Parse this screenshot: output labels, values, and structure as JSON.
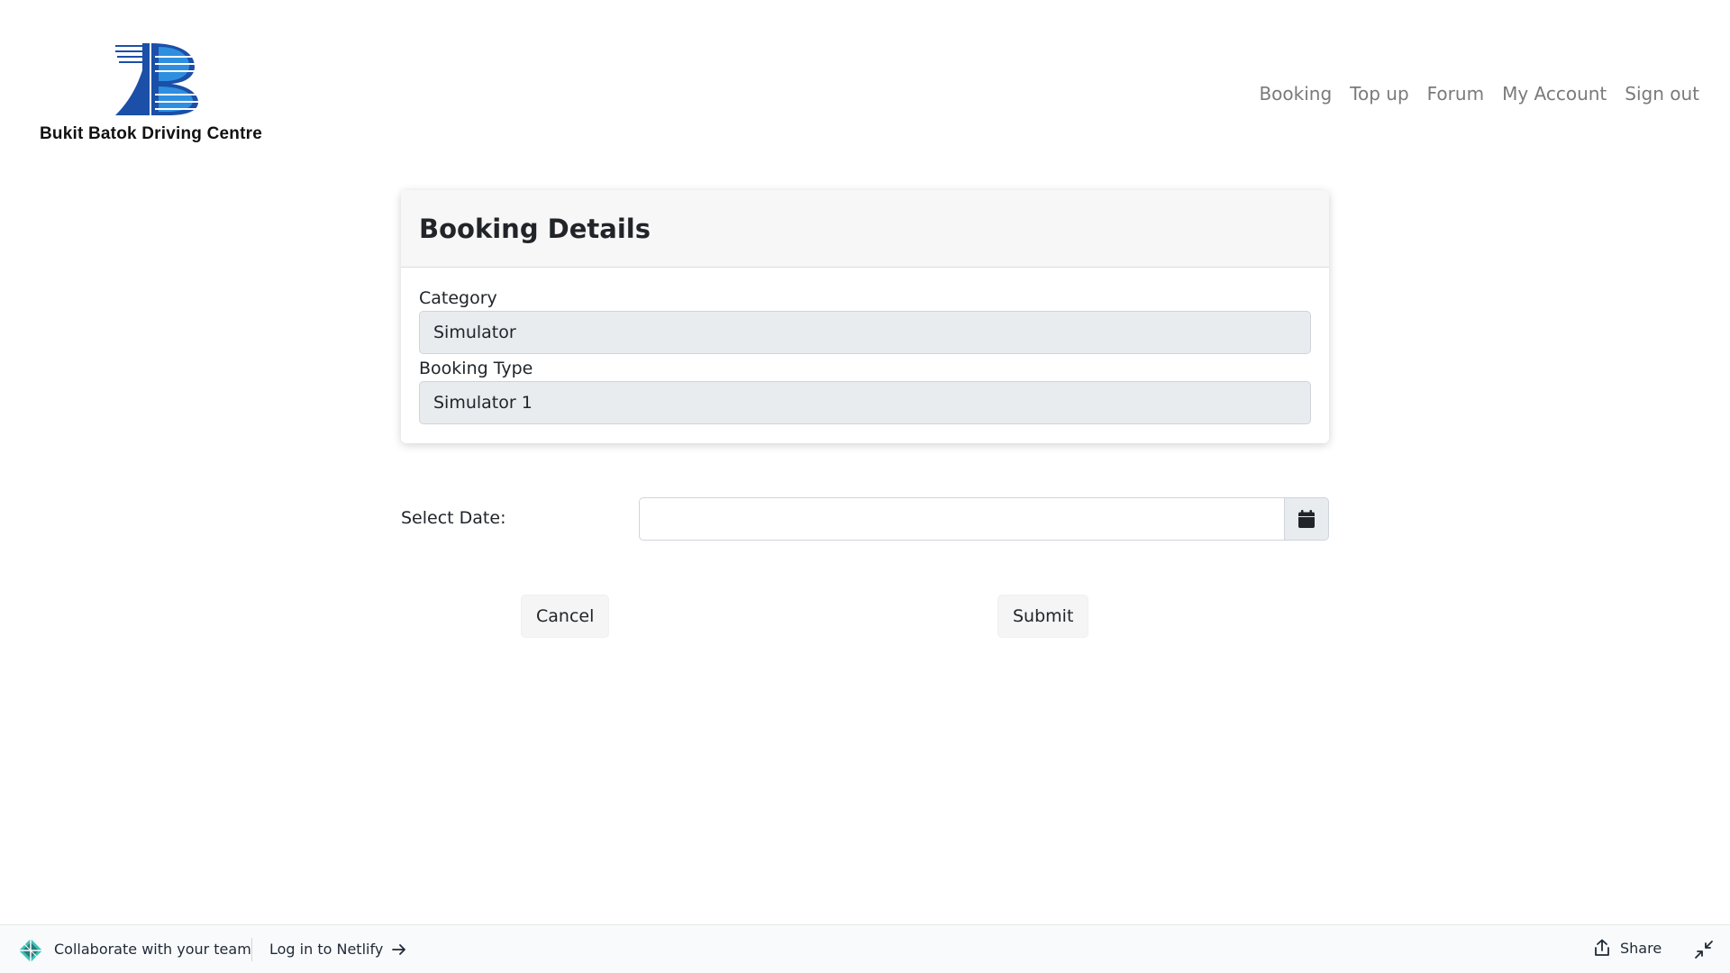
{
  "brand": {
    "name": "Bukit Batok Driving Centre",
    "logo_icon": "bbdc-logo-icon"
  },
  "nav": {
    "items": [
      "Booking",
      "Top up",
      "Forum",
      "My Account",
      "Sign out"
    ]
  },
  "card": {
    "title": "Booking Details",
    "category_label": "Category",
    "category_value": "Simulator",
    "booking_type_label": "Booking Type",
    "booking_type_value": "Simulator 1"
  },
  "date": {
    "label": "Select Date:",
    "value": "",
    "button_icon": "calendar-icon"
  },
  "actions": {
    "cancel_label": "Cancel",
    "submit_label": "Submit"
  },
  "netlify_bar": {
    "collaborate_text": "Collaborate with your team",
    "login_text": "Log in to Netlify",
    "share_text": "Share",
    "colors": {
      "logo_teal": "#3ec2b7",
      "logo_dark": "#2b7a78"
    }
  },
  "colors": {
    "logo_dark_blue": "#1b4fa8",
    "logo_light_blue": "#2e8fe0",
    "nav_text": "#7a7a7a",
    "readonly_bg": "#e9ecef"
  }
}
